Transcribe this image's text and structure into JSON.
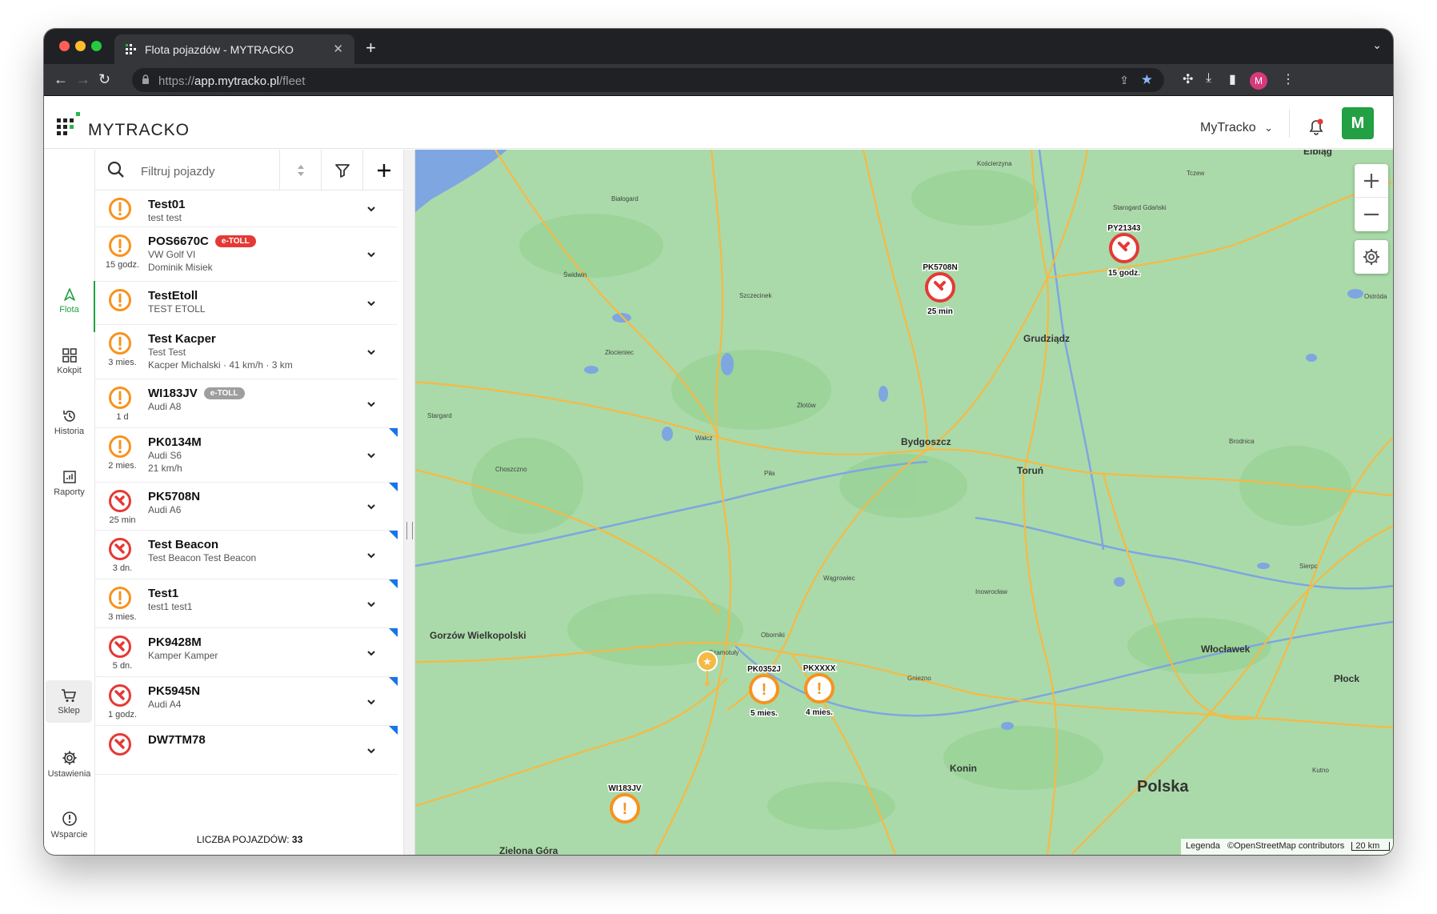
{
  "browser": {
    "tab_title": "Flota pojazdów - MYTRACKO",
    "url_prefix": "https://",
    "url_host": "app.mytracko.pl",
    "url_path": "/fleet",
    "profile_initial": "M"
  },
  "app": {
    "logo_text": "MYTRACKO",
    "account_name": "MyTracko",
    "avatar_initial": "M",
    "brand_color": "#22a043"
  },
  "rail": [
    {
      "label": "Flota",
      "icon": "navigation-arrow-icon",
      "active": true
    },
    {
      "label": "Kokpit",
      "icon": "dashboard-grid-icon"
    },
    {
      "label": "Historia",
      "icon": "history-icon"
    },
    {
      "label": "Raporty",
      "icon": "report-icon"
    },
    {
      "label": "Sklep",
      "icon": "cart-icon"
    },
    {
      "label": "Ustawienia",
      "icon": "gear-icon"
    },
    {
      "label": "Wsparcie",
      "icon": "support-icon"
    }
  ],
  "search": {
    "placeholder": "Filtruj pojazdy"
  },
  "vehicles": [
    {
      "name": "Test01",
      "line2": "test test",
      "line3": "",
      "age": "",
      "status": "warning",
      "badge": "",
      "marker": false
    },
    {
      "name": "POS6670C",
      "line2": "VW Golf VI",
      "line3": "Dominik Misiek",
      "age": "15 godz.",
      "status": "warning",
      "badge": "e-TOLL",
      "badge_style": "red",
      "marker": false
    },
    {
      "name": "TestEtoll",
      "line2": "TEST ETOLL",
      "line3": "",
      "age": "",
      "status": "warning",
      "badge": "",
      "marker": false
    },
    {
      "name": "Test Kacper",
      "line2": "Test Test",
      "line3": "Kacper Michalski · 41 km/h · 3 km",
      "age": "3 mies.",
      "status": "warning",
      "badge": "",
      "marker": false
    },
    {
      "name": "WI183JV",
      "line2": "Audi A8",
      "line3": "",
      "age": "1 d",
      "status": "warning",
      "badge": "e-TOLL",
      "badge_style": "gray",
      "marker": false
    },
    {
      "name": "PK0134M",
      "line2": "Audi S6",
      "line3": "21 km/h",
      "age": "2 mies.",
      "status": "warning",
      "badge": "",
      "marker": true
    },
    {
      "name": "PK5708N",
      "line2": "Audi A6",
      "line3": "",
      "age": "25 min",
      "status": "ignition",
      "badge": "",
      "marker": true
    },
    {
      "name": "Test Beacon",
      "line2": "Test Beacon Test Beacon",
      "line3": "",
      "age": "3 dn.",
      "status": "ignition",
      "badge": "",
      "marker": true
    },
    {
      "name": "Test1",
      "line2": "test1 test1",
      "line3": "",
      "age": "3 mies.",
      "status": "warning",
      "badge": "",
      "marker": true
    },
    {
      "name": "PK9428M",
      "line2": "Kamper Kamper",
      "line3": "",
      "age": "5 dn.",
      "status": "ignition",
      "badge": "",
      "marker": true
    },
    {
      "name": "PK5945N",
      "line2": "Audi A4",
      "line3": "",
      "age": "1 godz.",
      "status": "ignition",
      "badge": "",
      "marker": true
    },
    {
      "name": "DW7TM78",
      "line2": "",
      "line3": "",
      "age": "",
      "status": "ignition",
      "badge": "",
      "marker": true
    }
  ],
  "vehicle_count": {
    "label": "LICZBA POJAZDÓW:",
    "value": "33"
  },
  "map": {
    "cities_major": [
      "Bydgoszcz",
      "Toruń",
      "Grudziądz",
      "Włocławek",
      "Płock",
      "Konin",
      "Gorzów Wielkopolski",
      "Zielona Góra",
      "Elbląg"
    ],
    "country_label": "Polska",
    "towns": [
      "Kościerzyna",
      "Tczew",
      "Białogard",
      "Starogard Gdański",
      "Świdwin",
      "Szczecinek",
      "Ostróda",
      "Złocieniec",
      "Stargard",
      "Złotów",
      "Wałcz",
      "Brodnica",
      "Choszczno",
      "Piła",
      "Wągrowiec",
      "Inowrocław",
      "Sierpc",
      "Szamotuły",
      "Oborniki",
      "Gniezno",
      "Kutno"
    ],
    "markers": [
      {
        "plate": "PK5708N",
        "age": "25 min",
        "status": "ignition"
      },
      {
        "plate": "PY21343",
        "age": "15 godz.",
        "status": "ignition"
      },
      {
        "plate": "PK0352J",
        "age": "5 mies.",
        "status": "warning"
      },
      {
        "plate": "PKXXXX",
        "age": "4 mies.",
        "status": "warning"
      },
      {
        "plate": "WI183JV",
        "age": "",
        "status": "warning"
      }
    ],
    "attribution_legend": "Legenda",
    "attribution": "©OpenStreetMap contributors",
    "scale": "20 km"
  },
  "colors": {
    "warning": "#f7931e",
    "ignition": "#e53935",
    "corner": "#1a73e8"
  }
}
